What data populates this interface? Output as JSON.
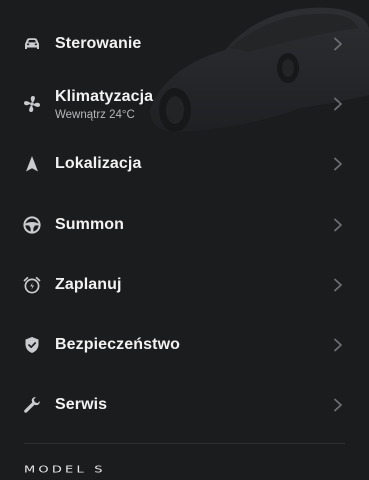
{
  "menu": {
    "items": [
      {
        "label": "Sterowanie",
        "icon": "car-icon"
      },
      {
        "label": "Klimatyzacja",
        "sublabel": "Wewnątrz 24°C",
        "icon": "fan-icon"
      },
      {
        "label": "Lokalizacja",
        "icon": "location-arrow-icon"
      },
      {
        "label": "Summon",
        "icon": "steering-wheel-icon"
      },
      {
        "label": "Zaplanuj",
        "icon": "alarm-clock-icon"
      },
      {
        "label": "Bezpieczeństwo",
        "icon": "shield-icon"
      },
      {
        "label": "Serwis",
        "icon": "wrench-icon"
      }
    ]
  },
  "footer": {
    "model_name": "MODEL S"
  },
  "colors": {
    "background": "#1b1c1e",
    "text": "#f2f2f2",
    "icon": "#c9cbce",
    "chevron": "#6b6e72",
    "sublabel": "#b5b7ba"
  }
}
